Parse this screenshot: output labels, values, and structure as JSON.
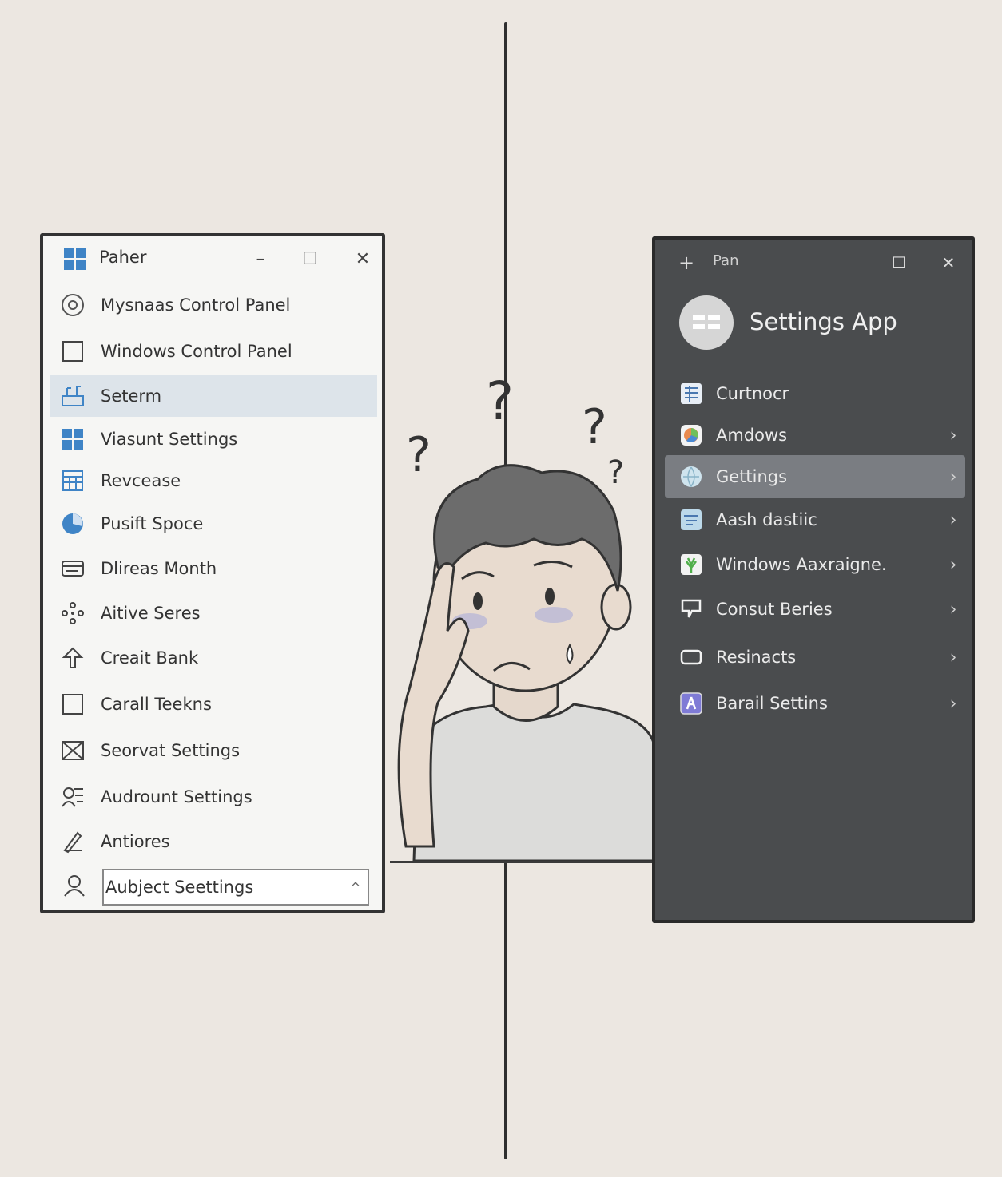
{
  "left_window": {
    "title": "Paher",
    "minimize": "–",
    "maximize": "☐",
    "close": "✕",
    "items": [
      {
        "label": "Mysnaas  Control Panel",
        "icon": "control-panel-icon"
      },
      {
        "label": "Windows Control Panel",
        "icon": "square-icon"
      },
      {
        "label": "Seterm",
        "icon": "system-icon",
        "selected": true
      },
      {
        "label": "Viasunt Settings",
        "icon": "windows-logo-icon"
      },
      {
        "label": "Revcease",
        "icon": "calendar-grid-icon"
      },
      {
        "label": "Pusift Spoce",
        "icon": "pie-chart-icon"
      },
      {
        "label": "Dlireas Month",
        "icon": "card-icon"
      },
      {
        "label": "Aitive Seres",
        "icon": "network-icon"
      },
      {
        "label": "Creait Bank",
        "icon": "arrow-up-icon"
      },
      {
        "label": "Carall Teekns",
        "icon": "square-icon"
      },
      {
        "label": "Seorvat Settings",
        "icon": "envelope-icon"
      },
      {
        "label": "Audrount Settings",
        "icon": "people-icon"
      },
      {
        "label": "Antiores",
        "icon": "pen-icon"
      }
    ],
    "dropdown": {
      "label": "Aubject Seettings",
      "icon": "user-icon",
      "chevron": "^"
    }
  },
  "right_window": {
    "title": "Pan",
    "add": "+",
    "maximize": "☐",
    "close": "✕",
    "app_title": "Settings App",
    "items": [
      {
        "label": "Curtnocr",
        "icon": "grid-doc-icon",
        "color": "#e8eef6",
        "chevron": ""
      },
      {
        "label": "Amdows",
        "icon": "color-wheel-icon",
        "color": "#e98a4e",
        "chevron": "›"
      },
      {
        "label": "Gettings",
        "icon": "globe-icon",
        "color": "#cfe4ee",
        "chevron": "›",
        "selected": true
      },
      {
        "label": "Aash dastiic",
        "icon": "window-icon",
        "color": "#bcd9ea",
        "chevron": "›"
      },
      {
        "label": "Windows Aaxraigne.",
        "icon": "plant-icon",
        "color": "#f2f2f2",
        "chevron": "›"
      },
      {
        "label": "Consut Beries",
        "icon": "speech-bubble-icon",
        "color": "#f2f2f2",
        "chevron": "›"
      },
      {
        "label": "Resinacts",
        "icon": "rectangle-icon",
        "color": "#f2f2f2",
        "chevron": "›"
      },
      {
        "label": "Barail Settins",
        "icon": "accessibility-icon",
        "color": "#7f7bd6",
        "chevron": "›"
      }
    ]
  },
  "illustration": {
    "marks": [
      "?",
      "?",
      "?",
      "?"
    ]
  },
  "colors": {
    "background": "#ece7e1",
    "light_window": "#f6f6f4",
    "dark_window": "#4a4c4e",
    "selected_light": "#dde4ea",
    "selected_dark": "#7a7d82"
  }
}
